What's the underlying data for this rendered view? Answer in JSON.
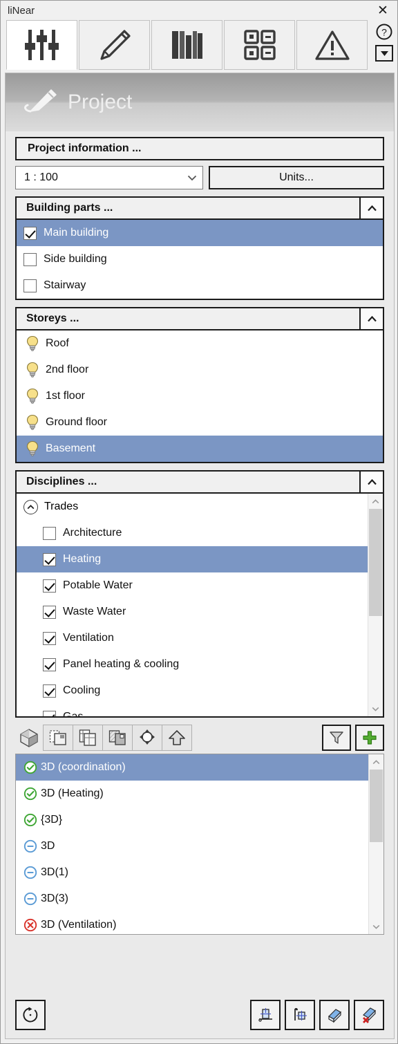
{
  "window": {
    "title": "liNear",
    "close_label": "✕"
  },
  "tabs": [
    {
      "name": "tab-sliders",
      "icon": "sliders-icon",
      "active": true
    },
    {
      "name": "tab-pencil",
      "icon": "pencil-icon",
      "active": false
    },
    {
      "name": "tab-books",
      "icon": "books-icon",
      "active": false
    },
    {
      "name": "tab-grid",
      "icon": "grid-icon",
      "active": false
    },
    {
      "name": "tab-warning",
      "icon": "warning-icon",
      "active": false
    }
  ],
  "tab_right": {
    "help_icon": "question-mark-icon",
    "dropdown_icon": "chevron-down-icon"
  },
  "hero": {
    "title": "Project",
    "icon": "pencil-icon"
  },
  "project": {
    "information_button": "Project information ...",
    "scale_value": "1 : 100",
    "units_button": "Units..."
  },
  "building_parts": {
    "title": "Building parts ...",
    "collapse_icon": "chevron-up-icon",
    "items": [
      {
        "label": "Main building",
        "checked": true,
        "selected": true
      },
      {
        "label": "Side building",
        "checked": false,
        "selected": false
      },
      {
        "label": "Stairway",
        "checked": false,
        "selected": false
      }
    ]
  },
  "storeys": {
    "title": "Storeys ...",
    "collapse_icon": "chevron-up-icon",
    "items": [
      {
        "label": "Roof",
        "icon": "lightbulb-icon",
        "selected": false
      },
      {
        "label": "2nd floor",
        "icon": "lightbulb-icon",
        "selected": false
      },
      {
        "label": "1st floor",
        "icon": "lightbulb-icon",
        "selected": false
      },
      {
        "label": "Ground floor",
        "icon": "lightbulb-icon",
        "selected": false
      },
      {
        "label": "Basement",
        "icon": "lightbulb-icon",
        "selected": true
      }
    ]
  },
  "disciplines": {
    "title": "Disciplines ...",
    "collapse_icon": "chevron-up-icon",
    "root": {
      "label": "Trades",
      "expanded": true,
      "toggle_icon": "circle-chevron-up-icon"
    },
    "items": [
      {
        "label": "Architecture",
        "checked": false,
        "selected": false
      },
      {
        "label": "Heating",
        "checked": true,
        "selected": true
      },
      {
        "label": "Potable Water",
        "checked": true,
        "selected": false
      },
      {
        "label": "Waste Water",
        "checked": true,
        "selected": false
      },
      {
        "label": "Ventilation",
        "checked": true,
        "selected": false
      },
      {
        "label": "Panel heating & cooling",
        "checked": true,
        "selected": false
      },
      {
        "label": "Cooling",
        "checked": true,
        "selected": false
      },
      {
        "label": "Gas",
        "checked": true,
        "selected": false
      }
    ],
    "scroll": {
      "up_icon": "chevron-up-icon",
      "down_icon": "chevron-down-icon"
    }
  },
  "view_toolbar": {
    "left_buttons": [
      {
        "name": "house-3d-icon",
        "active": true
      },
      {
        "name": "sheets-icon",
        "active": false
      },
      {
        "name": "plan-views-icon",
        "active": false
      },
      {
        "name": "sections-icon",
        "active": false
      },
      {
        "name": "elevation-marker-icon",
        "active": false
      },
      {
        "name": "up-arrow-icon",
        "active": false
      }
    ],
    "right_buttons": [
      {
        "name": "filter-icon"
      },
      {
        "name": "plus-icon"
      }
    ]
  },
  "views": {
    "items": [
      {
        "label": "3D (coordination)",
        "status": "ok",
        "selected": true
      },
      {
        "label": "3D (Heating)",
        "status": "ok",
        "selected": false
      },
      {
        "label": "{3D}",
        "status": "ok",
        "selected": false
      },
      {
        "label": "3D",
        "status": "neutral",
        "selected": false
      },
      {
        "label": "3D(1)",
        "status": "neutral",
        "selected": false
      },
      {
        "label": "3D(3)",
        "status": "neutral",
        "selected": false
      },
      {
        "label": "3D (Ventilation)",
        "status": "error",
        "selected": false
      }
    ],
    "scroll": {
      "up_icon": "chevron-up-icon",
      "down_icon": "chevron-down-icon"
    }
  },
  "bottom_bar": {
    "left": [
      {
        "name": "refresh-icon"
      }
    ],
    "right": [
      {
        "name": "section-box-icon"
      },
      {
        "name": "crop-region-icon"
      },
      {
        "name": "create-view-icon"
      },
      {
        "name": "delete-view-icon"
      }
    ]
  },
  "colors": {
    "selection": "#7b96c4",
    "status_ok": "#3fa635",
    "status_neutral": "#5b9bd5",
    "status_error": "#d9332b",
    "accent_green": "#4ca52c"
  }
}
